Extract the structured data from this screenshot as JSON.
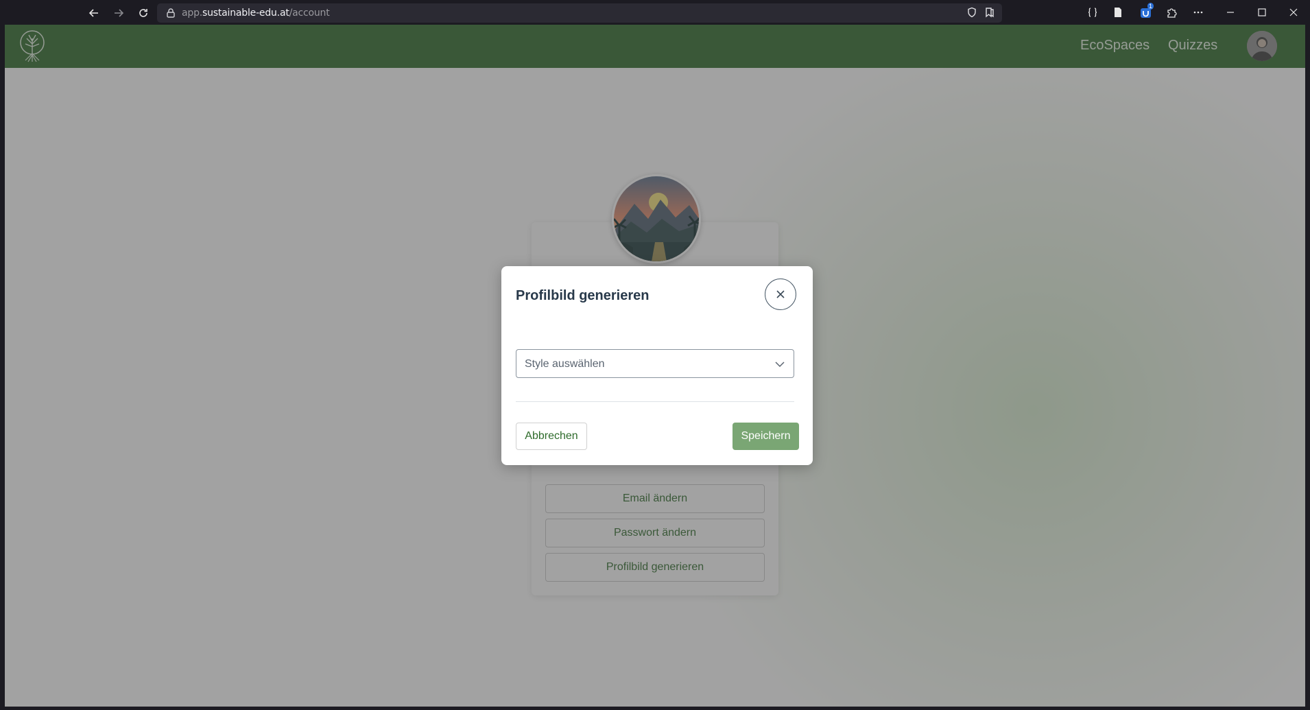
{
  "browser": {
    "url_prefix": "app.",
    "url_domain": "sustainable-edu.at",
    "url_path": "/account",
    "extension_badge": "1"
  },
  "header": {
    "nav": [
      {
        "label": "EcoSpaces"
      },
      {
        "label": "Quizzes"
      }
    ]
  },
  "account": {
    "buttons": [
      {
        "label": "Email ändern"
      },
      {
        "label": "Passwort ändern"
      },
      {
        "label": "Profilbild generieren"
      }
    ]
  },
  "modal": {
    "title": "Profilbild generieren",
    "select_placeholder": "Style auswählen",
    "cancel_label": "Abbrechen",
    "save_label": "Speichern"
  },
  "colors": {
    "header_green": "#2e6b2b",
    "accent_green": "#2e6b2b",
    "save_button": "#7aa674"
  }
}
